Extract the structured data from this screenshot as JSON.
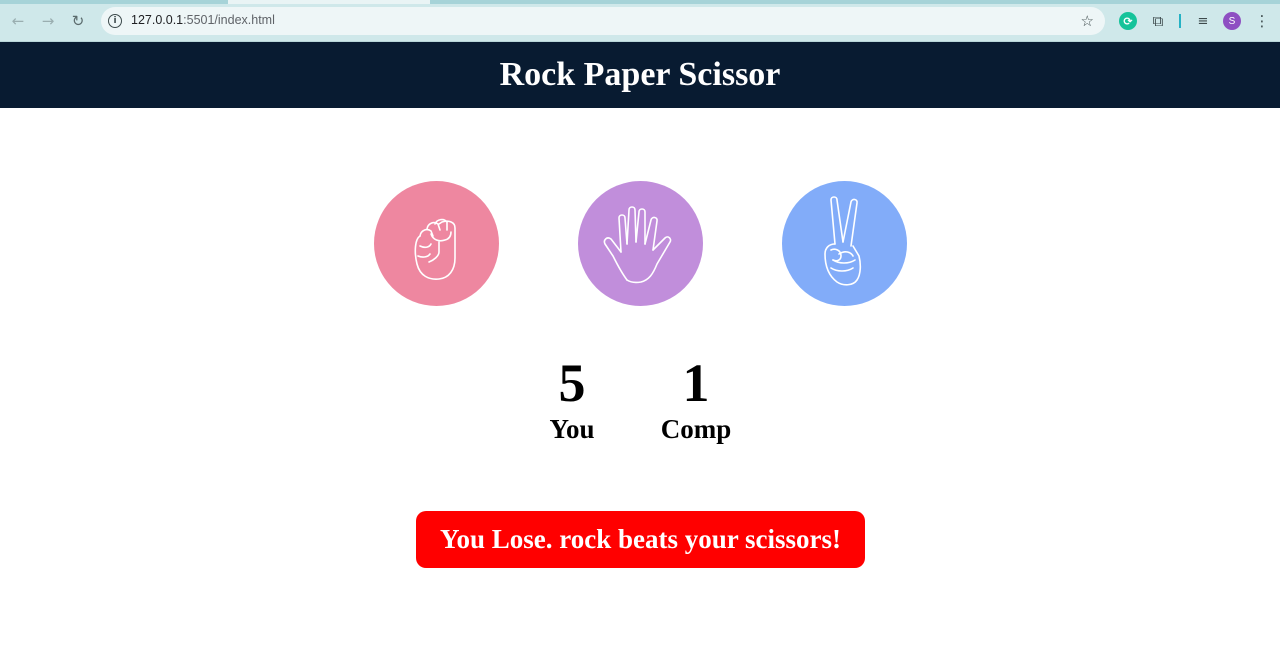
{
  "browser": {
    "url_host": "127.0.0.1",
    "url_rest": ":5501/index.html",
    "avatar_letter": "S",
    "icons": {
      "back": "back-arrow-icon",
      "forward": "forward-arrow-icon",
      "reload": "reload-icon",
      "site_info": "info-icon",
      "bookmark": "star-icon",
      "extension_1": "grammarly-icon",
      "extensions": "puzzle-icon",
      "reading_list": "queue-icon",
      "menu": "kebab-menu-icon"
    }
  },
  "header": {
    "title": "Rock Paper Scissor",
    "background": "#081b31"
  },
  "choices": [
    {
      "id": "rock",
      "icon": "fist-icon",
      "color": "#ee87a0"
    },
    {
      "id": "paper",
      "icon": "open-hand-icon",
      "color": "#c18edb"
    },
    {
      "id": "scissors",
      "icon": "peace-hand-icon",
      "color": "#82acf9"
    }
  ],
  "scoreboard": {
    "user": {
      "score": "5",
      "label": "You"
    },
    "comp": {
      "score": "1",
      "label": "Comp"
    }
  },
  "message": {
    "text": "You Lose. rock beats your scissors!",
    "color": "#ff0000"
  }
}
